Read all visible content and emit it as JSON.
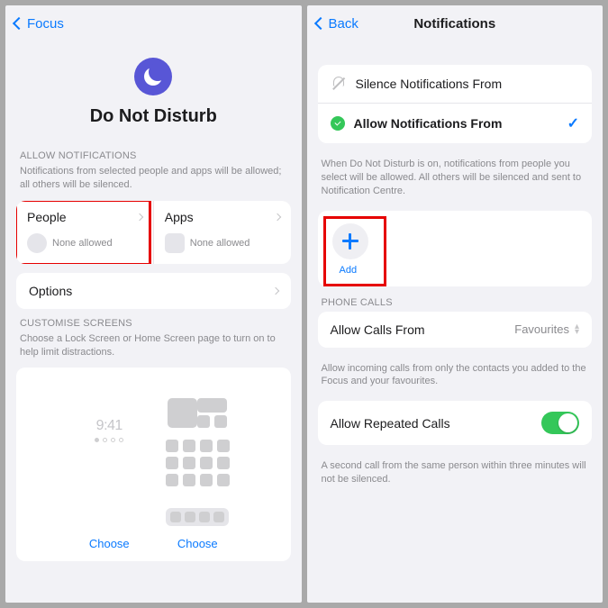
{
  "left": {
    "back": "Focus",
    "title": "Do Not Disturb",
    "allow_header": "ALLOW NOTIFICATIONS",
    "allow_desc": "Notifications from selected people and apps will be allowed; all others will be silenced.",
    "people": {
      "label": "People",
      "sub": "None allowed"
    },
    "apps": {
      "label": "Apps",
      "sub": "None allowed"
    },
    "options": "Options",
    "custom_header": "CUSTOMISE SCREENS",
    "custom_desc": "Choose a Lock Screen or Home Screen page to turn on to help limit distractions.",
    "lock_time": "9:41",
    "choose": "Choose"
  },
  "right": {
    "back": "Back",
    "title": "Notifications",
    "silence": "Silence Notifications From",
    "allow": "Allow Notifications From",
    "mode_desc": "When Do Not Disturb is on, notifications from people you select will be allowed. All others will be silenced and sent to Notification Centre.",
    "add": "Add",
    "calls_header": "PHONE CALLS",
    "allow_calls": "Allow Calls From",
    "allow_calls_value": "Favourites",
    "calls_desc": "Allow incoming calls from only the contacts you added to the Focus and your favourites.",
    "repeated": "Allow Repeated Calls",
    "repeated_desc": "A second call from the same person within three minutes will not be silenced."
  }
}
